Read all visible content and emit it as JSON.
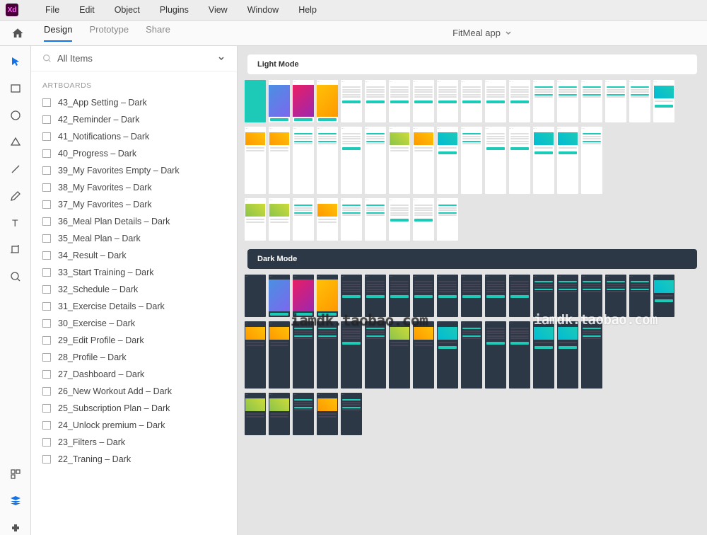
{
  "menubar": {
    "items": [
      "File",
      "Edit",
      "Object",
      "Plugins",
      "View",
      "Window",
      "Help"
    ]
  },
  "topbar": {
    "tabs": [
      "Design",
      "Prototype",
      "Share"
    ],
    "active_tab": 0,
    "doc_title": "FitMeal app"
  },
  "search": {
    "placeholder": "All Items"
  },
  "sidebar": {
    "section": "ARTBOARDS",
    "items": [
      "43_App Setting – Dark",
      "42_Reminder – Dark",
      "41_Notifications – Dark",
      "40_Progress – Dark",
      "39_My Favorites Empty – Dark",
      "38_My Favorites – Dark",
      "37_My Favorites – Dark",
      "36_Meal Plan Details – Dark",
      "35_Meal Plan – Dark",
      "34_Result – Dark",
      "33_Start Training – Dark",
      "32_Schedule – Dark",
      "31_Exercise Details – Dark",
      "30_Exercise – Dark",
      "29_Edit Profile – Dark",
      "28_Profile – Dark",
      "27_Dashboard – Dark",
      "26_New Workout Add – Dark",
      "25_Subscription Plan – Dark",
      "24_Unlock premium – Dark",
      "23_Filters – Dark",
      "22_Traning – Dark"
    ]
  },
  "canvas": {
    "section_light": "Light Mode",
    "section_dark": "Dark Mode"
  },
  "watermark": "iamdk.taobao.com"
}
